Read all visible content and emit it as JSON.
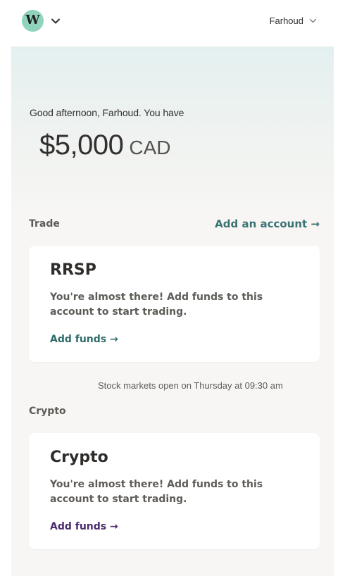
{
  "header": {
    "logo_letter": "W",
    "user_name": "Farhoud"
  },
  "summary": {
    "greeting": "Good afternoon, Farhoud. You have",
    "balance": "$5,000",
    "currency": "CAD"
  },
  "trade": {
    "section_title": "Trade",
    "add_account_label": "Add an account →",
    "card": {
      "title": "RRSP",
      "description": "You're almost there! Add funds to this account to start trading.",
      "link_label": "Add funds →"
    },
    "market_note": "Stock markets open on Thursday at 09:30 am"
  },
  "crypto": {
    "section_title": "Crypto",
    "card": {
      "title": "Crypto",
      "description": "You're almost there! Add funds to this account to start trading.",
      "link_label": "Add funds →"
    }
  },
  "colors": {
    "logo_bg": "#8fd3bd",
    "accent_teal": "#3b7373",
    "accent_purple": "#4a2a6e"
  },
  "icons": {
    "logo_menu": "chevron-down-icon",
    "user_menu": "chevron-down-icon"
  }
}
